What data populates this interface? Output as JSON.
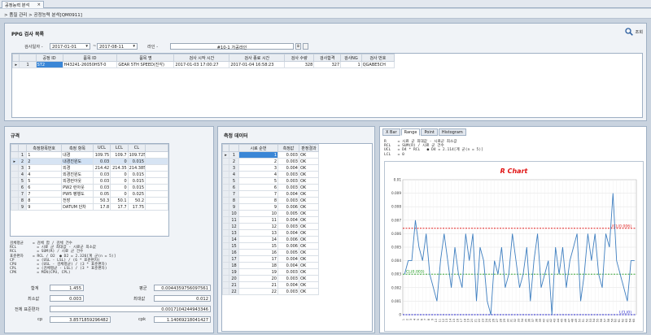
{
  "window": {
    "tab_label": "공정능력 분석",
    "close_glyph": "×"
  },
  "breadcrumb": "> 품질 관리 > 공정능력 분석[QM0911]",
  "inspection": {
    "section_title": "PPG 검사 목록",
    "search_label": "조회",
    "date_label": "검사일자 -",
    "date_from": "2017-01-01",
    "date_sep": "~",
    "date_to": "2017-08-11",
    "line_label": "라인 -",
    "line_value": "#10-1 가공라인",
    "columns": [
      "공정 ID",
      "품목 ID",
      "품목 명",
      "검사 시작 시간",
      "검사 종료 시간",
      "검사 수량",
      "검사합격",
      "검사NG",
      "검사 번호"
    ],
    "rows": [
      [
        "ST2",
        "H43241-26050HST-0",
        "GEAR 5TH SPEED(진각)",
        "2017-01-03 17:00:27",
        "2017-01-04 16:58:23",
        "328",
        "327",
        "1",
        "QGABE5CH"
      ]
    ]
  },
  "spec": {
    "section_title": "규격",
    "columns": [
      "측정항목번호",
      "측정 항목",
      "UCL",
      "LCL",
      "CL"
    ],
    "rows": [
      [
        "1",
        "1",
        "내경",
        "109.75",
        "109.7",
        "109.725"
      ],
      [
        "2",
        "2",
        "내경진원도",
        "0.03",
        "0",
        "0.015"
      ],
      [
        "3",
        "3",
        "외경",
        "214.42",
        "214.35",
        "214.385"
      ],
      [
        "4",
        "4",
        "외경진원도",
        "0.03",
        "0",
        "0.015"
      ],
      [
        "5",
        "5",
        "외경런아웃",
        "0.03",
        "0",
        "0.015"
      ],
      [
        "6",
        "6",
        "PW2 런아웃",
        "0.03",
        "0",
        "0.015"
      ],
      [
        "7",
        "7",
        "PW5 평행도",
        "0.05",
        "0",
        "0.025"
      ],
      [
        "8",
        "8",
        "전장",
        "50.3",
        "50.1",
        "50.2"
      ],
      [
        "9",
        "9",
        "DATUM 단차",
        "17.8",
        "17.7",
        "17.75"
      ]
    ],
    "formula_text": "검체평균    = 검체 합 / 검체 건수\nRCL         = 시료 군 최대값 - 시료군 최소값\nRCL         = SUM(R) / 시료 군 건수\n표준편차    = RCL / D2  ● D2 = 2.326[계 군(n = 5)]\nCP          = (USL - LSL) / (6 * 표준편차)\nCPU         = (USL - 검체평균) / (3 * 표준편차)\nCPL         = (검체평균 - LSL) / (3 * 표준편차)\nCPK         = MIN(CPU, CPL)"
  },
  "stats": {
    "sum_label": "합계",
    "sum_value": "1.455",
    "mean_label": "평균",
    "mean_value": "0.0044359756097561",
    "min_label": "최소값",
    "min_value": "0.003",
    "max_label": "최대값",
    "max_value": "0.012",
    "std_label": "전체 표준편차",
    "std_value": "0.0017104244943346",
    "cp_label": "cp",
    "cp_value": "3.8571859296482",
    "cpk_label": "cpk",
    "cpk_value": "1.14069218041427"
  },
  "measure": {
    "section_title": "측정 데이터",
    "columns": [
      "시료 순번",
      "측정값",
      "판정결과"
    ],
    "rows": [
      [
        "1",
        "1",
        "0.003",
        "OK"
      ],
      [
        "2",
        "2",
        "0.003",
        "OK"
      ],
      [
        "3",
        "3",
        "0.004",
        "OK"
      ],
      [
        "4",
        "4",
        "0.003",
        "OK"
      ],
      [
        "5",
        "5",
        "0.003",
        "OK"
      ],
      [
        "6",
        "6",
        "0.003",
        "OK"
      ],
      [
        "7",
        "7",
        "0.004",
        "OK"
      ],
      [
        "8",
        "8",
        "0.003",
        "OK"
      ],
      [
        "9",
        "9",
        "0.006",
        "OK"
      ],
      [
        "10",
        "10",
        "0.005",
        "OK"
      ],
      [
        "11",
        "11",
        "0.004",
        "OK"
      ],
      [
        "12",
        "12",
        "0.003",
        "OK"
      ],
      [
        "13",
        "13",
        "0.004",
        "OK"
      ],
      [
        "14",
        "14",
        "0.006",
        "OK"
      ],
      [
        "15",
        "15",
        "0.006",
        "OK"
      ],
      [
        "16",
        "16",
        "0.005",
        "OK"
      ],
      [
        "17",
        "17",
        "0.004",
        "OK"
      ],
      [
        "18",
        "18",
        "0.004",
        "OK"
      ],
      [
        "19",
        "19",
        "0.003",
        "OK"
      ],
      [
        "20",
        "20",
        "0.003",
        "OK"
      ],
      [
        "21",
        "21",
        "0.004",
        "OK"
      ],
      [
        "22",
        "22",
        "0.003",
        "OK"
      ]
    ]
  },
  "chart_panel": {
    "tabs": [
      "X Bar",
      "Range",
      "Point",
      "Histogram"
    ],
    "formula_text": "R     = 시료 군 최대값 - 시료군 최소값\nRCL   = SUM(R) / 시료 군 건수\nUCL   = D4 * RCL   ● D4 = 2.114[계 군(n = 5)]\nLCL   = 0"
  },
  "chart_data": {
    "type": "line",
    "title": "R Chart",
    "ylim": [
      0,
      0.01
    ],
    "yticks": [
      "0",
      "0.001",
      "0.002",
      "0.003",
      "0.004",
      "0.005",
      "0.006",
      "0.007",
      "0.008",
      "0.009",
      "0.01"
    ],
    "x": [
      "1",
      "2",
      "3",
      "4",
      "5",
      "6",
      "7",
      "8",
      "9",
      "10",
      "11",
      "12",
      "13",
      "14",
      "15",
      "16",
      "17",
      "18",
      "19",
      "20",
      "21",
      "22",
      "23",
      "24",
      "25",
      "26",
      "27",
      "28",
      "29",
      "30",
      "31",
      "32",
      "33",
      "34",
      "35",
      "36",
      "37",
      "38",
      "39",
      "40",
      "41",
      "42",
      "43",
      "44",
      "45",
      "46",
      "47",
      "48",
      "49",
      "50",
      "51",
      "52",
      "53",
      "54",
      "55",
      "56",
      "57",
      "58",
      "59",
      "60",
      "61",
      "62",
      "63",
      "64",
      "65"
    ],
    "series": [
      {
        "values": [
          0.003,
          0.004,
          0.004,
          0.007,
          0.005,
          0.004,
          0.006,
          0.003,
          0.002,
          0.001,
          0.004,
          0.006,
          0.004,
          0.002,
          0.005,
          0.003,
          0.002,
          0.006,
          0.004,
          0.006,
          0.001,
          0.005,
          0.004,
          0.001,
          0.0,
          0.004,
          0.003,
          0.005,
          0.002,
          0.003,
          0.006,
          0.004,
          0.002,
          0.003,
          0.005,
          0.001,
          0.004,
          0.006,
          0.002,
          0.003,
          0.004,
          0.0,
          0.005,
          0.003,
          0.005,
          0.002,
          0.004,
          0.005,
          0.006,
          0.001,
          0.003,
          0.006,
          0.004,
          0.006,
          0.003,
          0.002,
          0.006,
          0.005,
          0.009,
          0.004,
          0.003,
          0.002,
          0.001,
          0.004,
          0.004
        ]
      }
    ],
    "lines": [
      {
        "label": "UCL(0.006)",
        "value": 0.0064,
        "color": "#e02020"
      },
      {
        "label": "CL(0.003)",
        "value": 0.003,
        "color": "#1a9a1a"
      },
      {
        "label": "LCL(0)",
        "value": 0.0,
        "color": "#2222cc"
      }
    ],
    "grid": true,
    "line_color": "#3f7fc0"
  }
}
